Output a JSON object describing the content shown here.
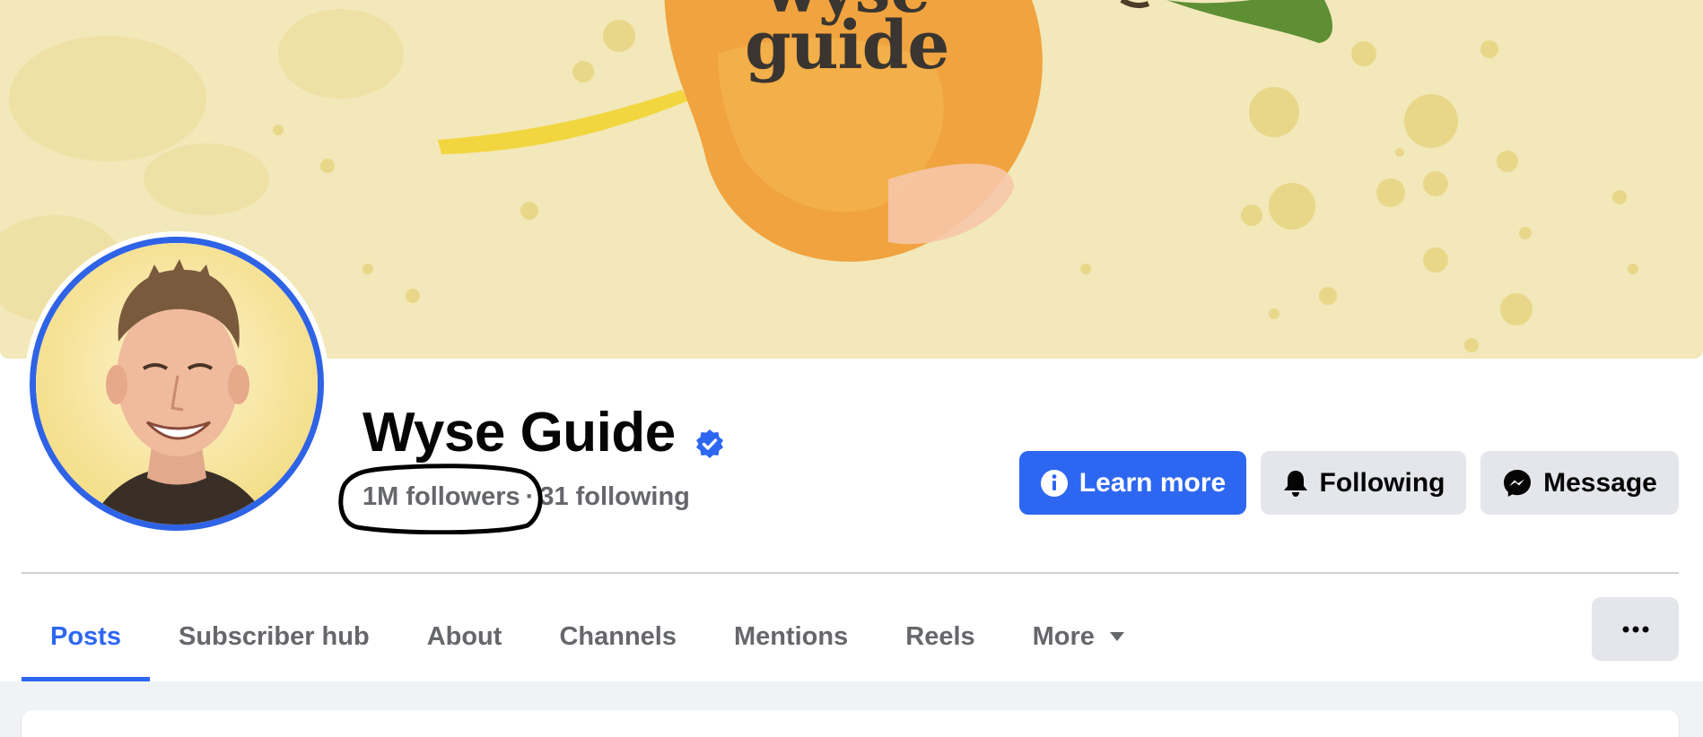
{
  "cover": {
    "logo_text_top": "wyse",
    "logo_text": "guide"
  },
  "profile": {
    "name": "Wyse Guide",
    "followers": "1M followers",
    "separator": "·",
    "following": "31 following"
  },
  "actions": {
    "learn_more": "Learn more",
    "following": "Following",
    "message": "Message"
  },
  "tabs": [
    {
      "label": "Posts",
      "active": true
    },
    {
      "label": "Subscriber hub",
      "active": false
    },
    {
      "label": "About",
      "active": false
    },
    {
      "label": "Channels",
      "active": false
    },
    {
      "label": "Mentions",
      "active": false
    },
    {
      "label": "Reels",
      "active": false
    },
    {
      "label": "More",
      "active": false
    }
  ],
  "icons": {
    "verified": "verified-badge-icon",
    "info": "info-icon",
    "bell": "bell-icon",
    "messenger": "messenger-icon",
    "caret": "caret-down-icon",
    "ellipsis": "ellipsis-icon"
  },
  "colors": {
    "accent": "#2d67f1",
    "avatar_ring": "#2f63e6",
    "secondary_button": "#e4e6eb",
    "muted_text": "#65676b",
    "cover_bg": "#f2e7b7"
  }
}
